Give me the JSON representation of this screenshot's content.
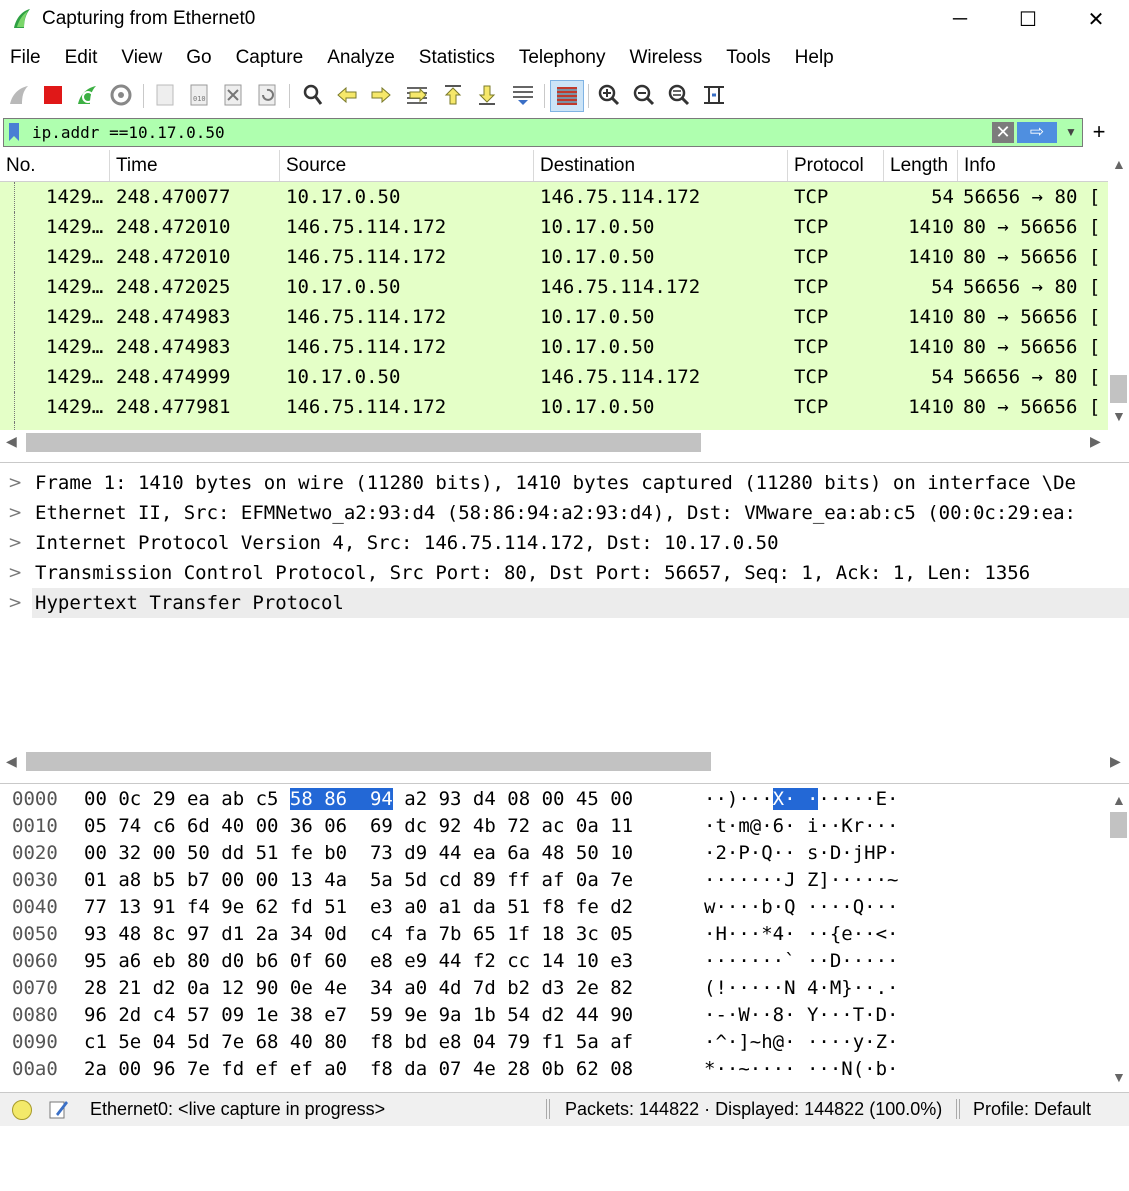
{
  "window": {
    "title": "Capturing from Ethernet0",
    "minimize": "─",
    "maximize": "☐",
    "close": "✕"
  },
  "menu": [
    "File",
    "Edit",
    "View",
    "Go",
    "Capture",
    "Analyze",
    "Statistics",
    "Telephony",
    "Wireless",
    "Tools",
    "Help"
  ],
  "toolbar": {
    "icons": [
      "shark-fin-start-icon",
      "stop-capture-icon",
      "restart-capture-icon",
      "capture-options-icon",
      "open-file-icon",
      "save-file-icon",
      "close-file-icon",
      "reload-file-icon",
      "find-packet-icon",
      "go-back-icon",
      "go-forward-icon",
      "go-to-packet-icon",
      "go-first-packet-icon",
      "go-last-packet-icon",
      "auto-scroll-icon",
      "colorize-icon",
      "zoom-in-icon",
      "zoom-out-icon",
      "normal-size-icon",
      "resize-columns-icon"
    ]
  },
  "filter": {
    "value": "ip.addr ==10.17.0.50",
    "clear": "✕",
    "apply": "⇨",
    "add": "+",
    "bg_color": "#afffaf"
  },
  "packet_list": {
    "columns": [
      "No.",
      "Time",
      "Source",
      "Destination",
      "Protocol",
      "Length",
      "Info"
    ],
    "rows": [
      {
        "no": "1429…",
        "time": "248.470077",
        "source": "10.17.0.50",
        "destination": "146.75.114.172",
        "protocol": "TCP",
        "length": "54",
        "info": "56656 → 80 ["
      },
      {
        "no": "1429…",
        "time": "248.472010",
        "source": "146.75.114.172",
        "destination": "10.17.0.50",
        "protocol": "TCP",
        "length": "1410",
        "info": "80 → 56656 ["
      },
      {
        "no": "1429…",
        "time": "248.472010",
        "source": "146.75.114.172",
        "destination": "10.17.0.50",
        "protocol": "TCP",
        "length": "1410",
        "info": "80 → 56656 ["
      },
      {
        "no": "1429…",
        "time": "248.472025",
        "source": "10.17.0.50",
        "destination": "146.75.114.172",
        "protocol": "TCP",
        "length": "54",
        "info": "56656 → 80 ["
      },
      {
        "no": "1429…",
        "time": "248.474983",
        "source": "146.75.114.172",
        "destination": "10.17.0.50",
        "protocol": "TCP",
        "length": "1410",
        "info": "80 → 56656 ["
      },
      {
        "no": "1429…",
        "time": "248.474983",
        "source": "146.75.114.172",
        "destination": "10.17.0.50",
        "protocol": "TCP",
        "length": "1410",
        "info": "80 → 56656 ["
      },
      {
        "no": "1429…",
        "time": "248.474999",
        "source": "10.17.0.50",
        "destination": "146.75.114.172",
        "protocol": "TCP",
        "length": "54",
        "info": "56656 → 80 ["
      },
      {
        "no": "1429…",
        "time": "248.477981",
        "source": "146.75.114.172",
        "destination": "10.17.0.50",
        "protocol": "TCP",
        "length": "1410",
        "info": "80 → 56656 ["
      }
    ],
    "row_color": "#e4ffc7"
  },
  "details": [
    "Frame 1: 1410 bytes on wire (11280 bits), 1410 bytes captured (11280 bits) on interface \\De",
    "Ethernet II, Src: EFMNetwo_a2:93:d4 (58:86:94:a2:93:d4), Dst: VMware_ea:ab:c5 (00:0c:29:ea:",
    "Internet Protocol Version 4, Src: 146.75.114.172, Dst: 10.17.0.50",
    "Transmission Control Protocol, Src Port: 80, Dst Port: 56657, Seq: 1, Ack: 1, Len: 1356",
    "Hypertext Transfer Protocol"
  ],
  "bytes": [
    {
      "offset": "0000",
      "hex_a": "00 0c 29 ea ab c5 ",
      "hex_hl": "58 86  94",
      "hex_b": " a2 93 d4 08 00 45 00",
      "asc_a": "··)···",
      "asc_hl": "X· ·",
      "asc_b": "·····E·"
    },
    {
      "offset": "0010",
      "hex": "05 74 c6 6d 40 00 36 06  69 dc 92 4b 72 ac 0a 11",
      "ascii": "·t·m@·6· i··Kr···"
    },
    {
      "offset": "0020",
      "hex": "00 32 00 50 dd 51 fe b0  73 d9 44 ea 6a 48 50 10",
      "ascii": "·2·P·Q·· s·D·jHP·"
    },
    {
      "offset": "0030",
      "hex": "01 a8 b5 b7 00 00 13 4a  5a 5d cd 89 ff af 0a 7e",
      "ascii": "·······J Z]·····~"
    },
    {
      "offset": "0040",
      "hex": "77 13 91 f4 9e 62 fd 51  e3 a0 a1 da 51 f8 fe d2",
      "ascii": "w····b·Q ····Q···"
    },
    {
      "offset": "0050",
      "hex": "93 48 8c 97 d1 2a 34 0d  c4 fa 7b 65 1f 18 3c 05",
      "ascii": "·H···*4· ··{e··<·"
    },
    {
      "offset": "0060",
      "hex": "95 a6 eb 80 d0 b6 0f 60  e8 e9 44 f2 cc 14 10 e3",
      "ascii": "·······` ··D·····"
    },
    {
      "offset": "0070",
      "hex": "28 21 d2 0a 12 90 0e 4e  34 a0 4d 7d b2 d3 2e 82",
      "ascii": "(!·····N 4·M}··.·"
    },
    {
      "offset": "0080",
      "hex": "96 2d c4 57 09 1e 38 e7  59 9e 9a 1b 54 d2 44 90",
      "ascii": "·-·W··8· Y···T·D·"
    },
    {
      "offset": "0090",
      "hex": "c1 5e 04 5d 7e 68 40 80  f8 bd e8 04 79 f1 5a af",
      "ascii": "·^·]~h@· ····y·Z·"
    },
    {
      "offset": "00a0",
      "hex": "2a 00 96 7e fd ef ef a0  f8 da 07 4e 28 0b 62 08",
      "ascii": "*··~···· ···N(·b·"
    }
  ],
  "status": {
    "interface": "Ethernet0: <live capture in progress>",
    "packets": "Packets: 144822 · Displayed: 144822 (100.0%)",
    "profile": "Profile: Default"
  }
}
